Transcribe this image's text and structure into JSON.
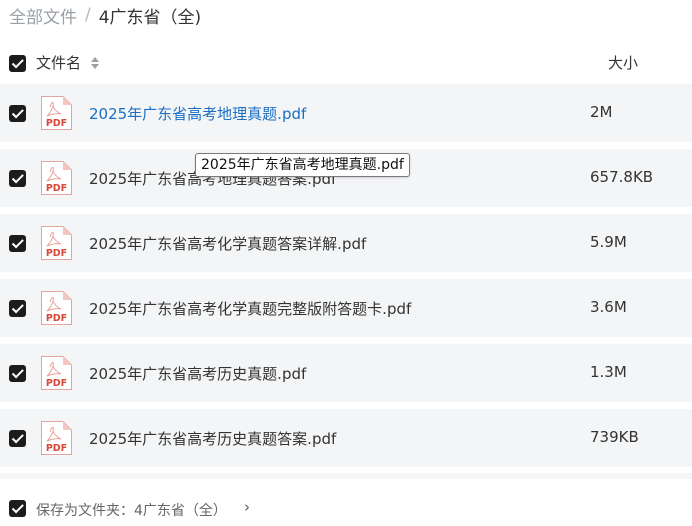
{
  "breadcrumb": {
    "root": "全部文件",
    "separator": "/",
    "current": "4广东省（全)"
  },
  "table": {
    "header": {
      "name_label": "文件名",
      "size_label": "大小",
      "sort_icon": "sort-icon"
    },
    "file_icon": "pdf-icon",
    "file_icon_text": "PDF",
    "rows": [
      {
        "name": "2025年广东省高考地理真题.pdf",
        "size": "2M"
      },
      {
        "name": "2025年广东省高考地理真题答案.pdf",
        "size": "657.8KB"
      },
      {
        "name": "2025年广东省高考化学真题答案详解.pdf",
        "size": "5.9M"
      },
      {
        "name": "2025年广东省高考化学真题完整版附答题卡.pdf",
        "size": "3.6M"
      },
      {
        "name": "2025年广东省高考历史真题.pdf",
        "size": "1.3M"
      },
      {
        "name": "2025年广东省高考历史真题答案.pdf",
        "size": "739KB"
      }
    ]
  },
  "tooltip": {
    "text": "2025年广东省高考地理真题.pdf"
  },
  "footer": {
    "save_label": "保存为文件夹：4广东省（全）",
    "chevron": "›"
  },
  "colors": {
    "link": "#1a6fc4",
    "row_background": "#f4f5f6",
    "checkbox": "#1c1c1c",
    "pdf_red": "#d9463a"
  }
}
